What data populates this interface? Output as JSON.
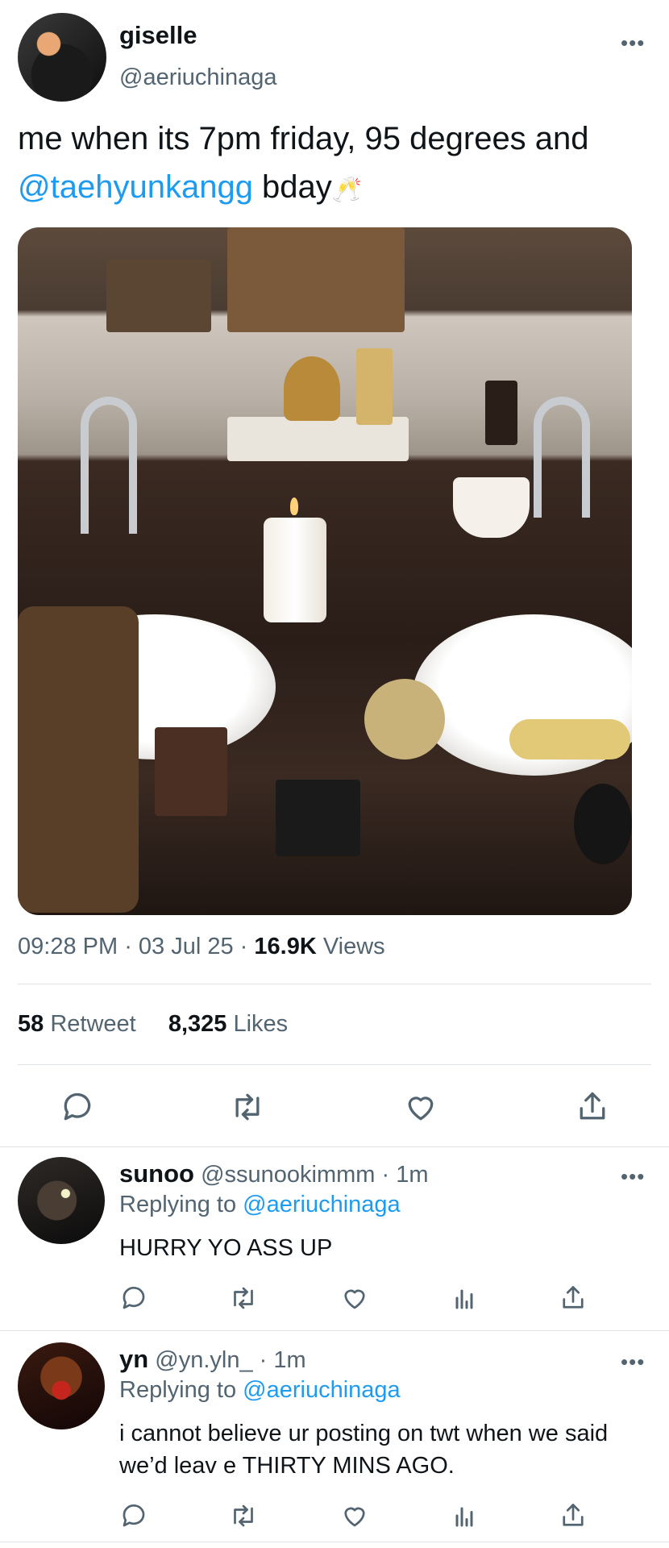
{
  "tweet": {
    "author_name": "giselle",
    "author_handle": "@aeriuchinaga",
    "more": "•••",
    "text_line1": "me when its 7pm friday, 95 degrees and",
    "mention": "@taehyunkangg",
    "text_after_mention": " bday",
    "emoji": "🥂",
    "time": "09:28 PM",
    "sep": " · ",
    "date": "03 Jul 25",
    "views_count": "16.9K",
    "views_label": " Views",
    "retweet_count": "58",
    "retweet_label": " Retweet",
    "likes_count": "8,325",
    "likes_label": " Likes"
  },
  "replies": [
    {
      "name": "sunoo",
      "handle": "@ssunookimmm",
      "time": "· 1m",
      "replying_label": "Replying to ",
      "replying_to": "@aeriuchinaga",
      "text": "HURRY YO ASS UP"
    },
    {
      "name": "yn",
      "handle": "@yn.yln_",
      "time": "· 1m",
      "replying_label": "Replying to ",
      "replying_to": "@aeriuchinaga",
      "text": "i cannot believe ur posting on twt when we said we’d leav e THIRTY MINS AGO."
    }
  ],
  "icons": [
    "reply-icon",
    "retweet-icon",
    "like-icon",
    "share-icon",
    "views-icon",
    "more-icon"
  ],
  "colors": {
    "accent": "#1d9bf0",
    "text": "#0f1419",
    "secondary": "#536471",
    "divider": "#dfe3e6"
  }
}
